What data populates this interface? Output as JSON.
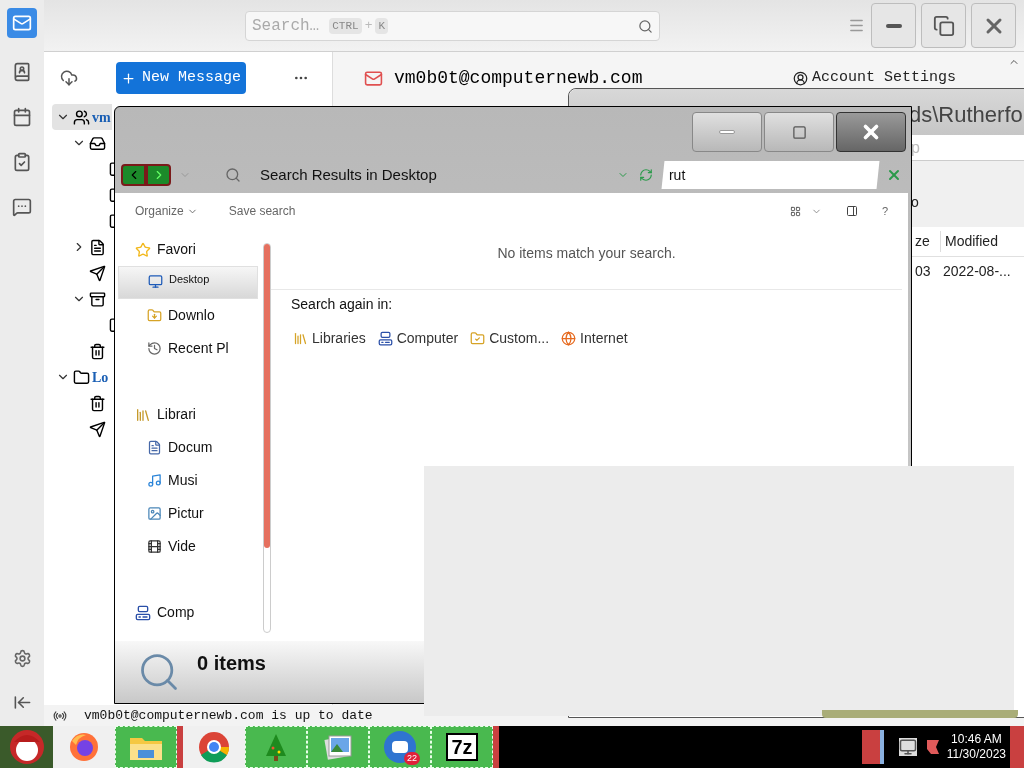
{
  "mail": {
    "search": {
      "placeholder": "Search…",
      "keys": [
        "CTRL",
        "+",
        "K"
      ]
    },
    "new_message": "New Message",
    "folders": [
      {
        "label": "vm",
        "expanded": true,
        "selected": true
      },
      {
        "label": "Lo",
        "expanded": true,
        "selected": false
      }
    ],
    "account": "vm0b0t@computernewb.com",
    "account_settings": "Account Settings",
    "status": "vm0b0t@computernewb.com is up to date"
  },
  "back_window": {
    "title": "ds\\Rutherfo",
    "search": "p",
    "label": "o",
    "columns": [
      "ze",
      "Modified"
    ],
    "row": [
      "03",
      "2022-08-..."
    ]
  },
  "explorer": {
    "address": "Search Results in Desktop",
    "search": "rut",
    "toolbar": [
      "Organize",
      "Save search"
    ],
    "help": "?",
    "nav": [
      {
        "label": "Favori",
        "selected": false,
        "children": [
          {
            "label": "Desktop",
            "selected": true
          },
          {
            "label": "Downlo",
            "selected": false
          },
          {
            "label": "Recent Pl",
            "selected": false
          }
        ]
      },
      {
        "label": "Librari",
        "selected": false,
        "children": [
          {
            "label": "Docum",
            "selected": false
          },
          {
            "label": "Musi",
            "selected": false
          },
          {
            "label": "Pictur",
            "selected": false
          },
          {
            "label": "Vide",
            "selected": false
          }
        ]
      },
      {
        "label": "Comp",
        "selected": false
      }
    ],
    "message": "No items match your search.",
    "search_again": "Search again in:",
    "locations": [
      "Libraries",
      "Computer",
      "Custom...",
      "Internet"
    ],
    "status": "0 items"
  },
  "taskbar": {
    "apps": [
      {
        "kind": "fox"
      },
      {
        "kind": "folder"
      },
      {
        "kind": "ring"
      },
      {
        "kind": "tree"
      },
      {
        "kind": "photos"
      },
      {
        "kind": "mail",
        "badge": "22"
      },
      {
        "kind": "archive",
        "label": "7z"
      }
    ],
    "time": "10:46 AM",
    "date": "11/30/2023"
  }
}
